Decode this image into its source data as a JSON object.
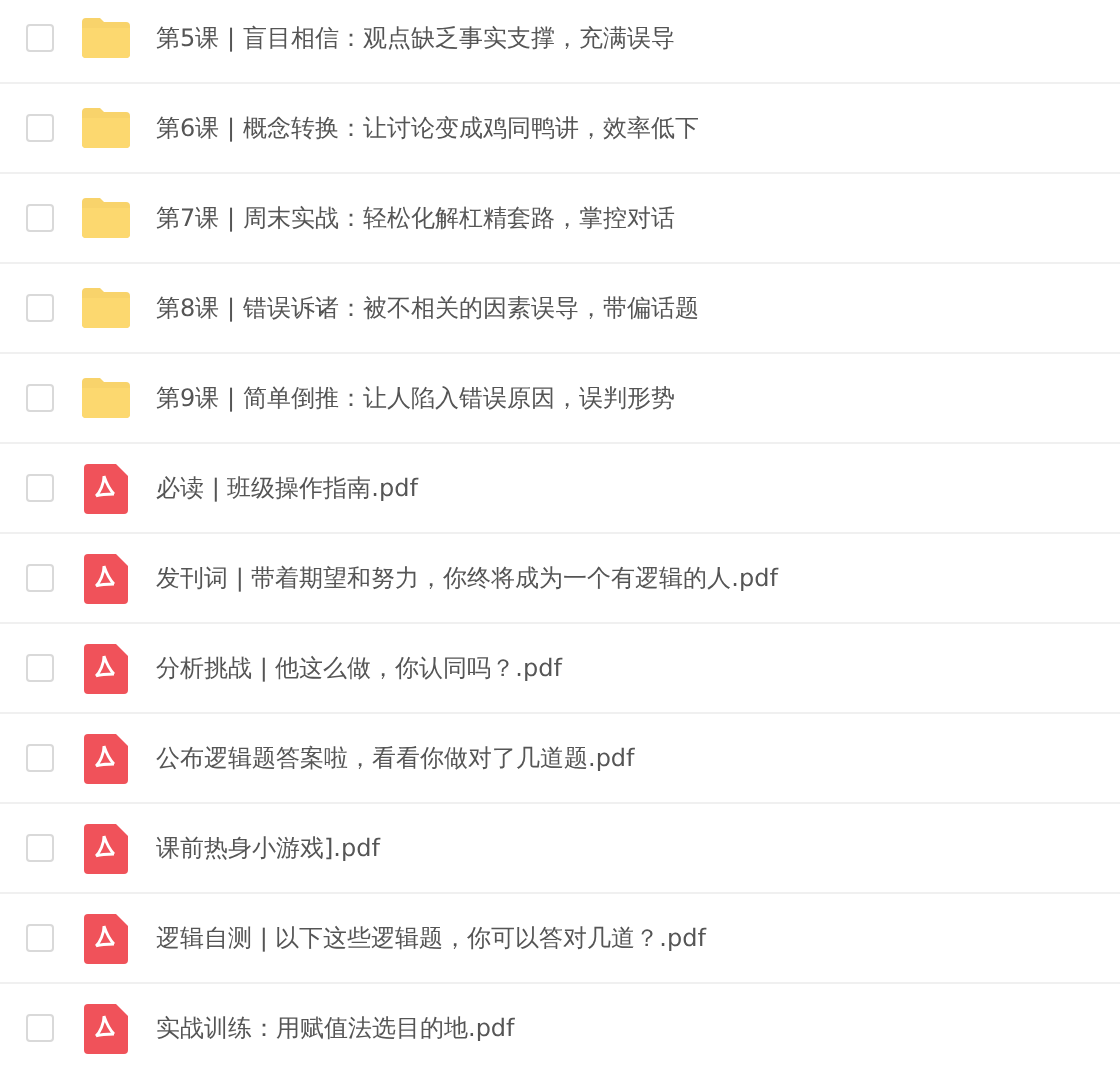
{
  "files": [
    {
      "kind": "folder",
      "name": "第5课 | 盲目相信：观点缺乏事实支撑，充满误导",
      "checked": false
    },
    {
      "kind": "folder",
      "name": "第6课 | 概念转换：让讨论变成鸡同鸭讲，效率低下",
      "checked": false
    },
    {
      "kind": "folder",
      "name": "第7课 | 周末实战：轻松化解杠精套路，掌控对话",
      "checked": false
    },
    {
      "kind": "folder",
      "name": "第8课 | 错误诉诸：被不相关的因素误导，带偏话题",
      "checked": false
    },
    {
      "kind": "folder",
      "name": "第9课 | 简单倒推：让人陷入错误原因，误判形势",
      "checked": false
    },
    {
      "kind": "pdf",
      "name": "必读 | 班级操作指南.pdf",
      "checked": false
    },
    {
      "kind": "pdf",
      "name": "发刊词 | 带着期望和努力，你终将成为一个有逻辑的人.pdf",
      "checked": false
    },
    {
      "kind": "pdf",
      "name": "分析挑战 | 他这么做，你认同吗？.pdf",
      "checked": false
    },
    {
      "kind": "pdf",
      "name": "公布逻辑题答案啦，看看你做对了几道题.pdf",
      "checked": false
    },
    {
      "kind": "pdf",
      "name": "课前热身小游戏].pdf",
      "checked": false
    },
    {
      "kind": "pdf",
      "name": "逻辑自测 | 以下这些逻辑题，你可以答对几道？.pdf",
      "checked": false
    },
    {
      "kind": "pdf",
      "name": "实战训练：用赋值法选目的地.pdf",
      "checked": false
    }
  ]
}
